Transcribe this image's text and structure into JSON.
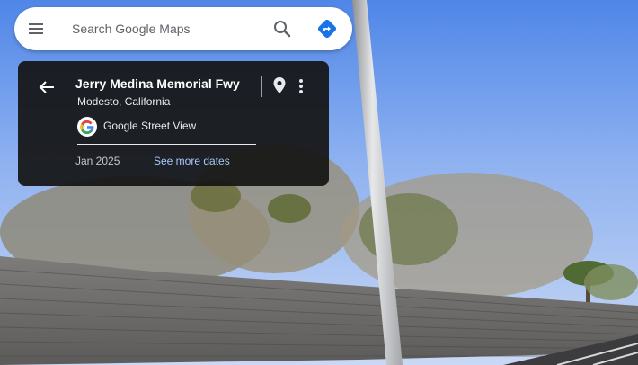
{
  "search": {
    "placeholder": "Search Google Maps",
    "menu_icon": "hamburger-menu-icon",
    "search_icon": "magnifier-icon",
    "directions_icon": "directions-icon",
    "directions_color": "#1a73e8"
  },
  "place_card": {
    "name": "Jerry Medina Memorial Fwy",
    "location": "Modesto, California",
    "provider": "Google Street View",
    "capture_date": "Jan 2025",
    "more_dates_label": "See more dates",
    "link_color": "#a8c7fa"
  }
}
